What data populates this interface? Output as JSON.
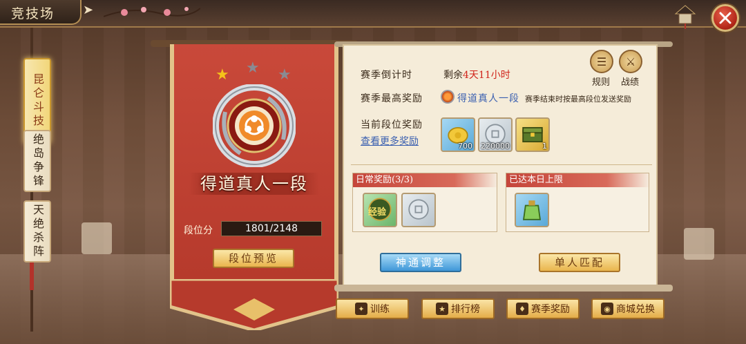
{
  "header": {
    "title": "竞技场"
  },
  "left_tabs": [
    {
      "label": "昆仑斗技",
      "active": true
    },
    {
      "label": "绝岛争锋",
      "active": false
    },
    {
      "label": "天绝杀阵",
      "active": false
    }
  ],
  "rank": {
    "name": "得道真人一段",
    "stars_filled": 1,
    "stars_total": 3,
    "score_label": "段位分",
    "score_value": "1801/2148",
    "preview_button": "段位预览"
  },
  "season": {
    "countdown_label": "赛季倒计时",
    "countdown_prefix": "剩余",
    "countdown_value": "4天11小时",
    "top_reward_label": "赛季最高奖励",
    "top_reward_name": "得道真人一段",
    "top_reward_note": "赛季结束时按最高段位发送奖励",
    "current_reward_label": "当前段位奖励",
    "more_rewards_link": "查看更多奖励",
    "items": [
      {
        "icon": "gold-ingot-icon",
        "count": "700"
      },
      {
        "icon": "silver-coin-icon",
        "count": "220000"
      },
      {
        "icon": "treasure-chest-icon",
        "count": "1"
      }
    ]
  },
  "top_buttons": {
    "rules": "规则",
    "record": "战绩"
  },
  "daily": {
    "title": "日常奖励(3/3)",
    "items": [
      {
        "icon": "exp-badge-icon",
        "text": "经验"
      },
      {
        "icon": "silver-coin-icon"
      }
    ]
  },
  "limit": {
    "title": "已达本日上限",
    "items": [
      {
        "icon": "jade-pouch-icon"
      }
    ]
  },
  "actions": {
    "adjust": "神通调整",
    "match": "单人匹配"
  },
  "bottom_buttons": [
    {
      "label": "训练",
      "icon": "train-icon"
    },
    {
      "label": "排行榜",
      "icon": "ranking-icon"
    },
    {
      "label": "赛季奖励",
      "icon": "season-reward-icon"
    },
    {
      "label": "商城兑换",
      "icon": "shop-icon"
    }
  ],
  "colors": {
    "accent_red": "#d0231a",
    "link_blue": "#3a5fb0",
    "banner_red": "#c9493a"
  }
}
